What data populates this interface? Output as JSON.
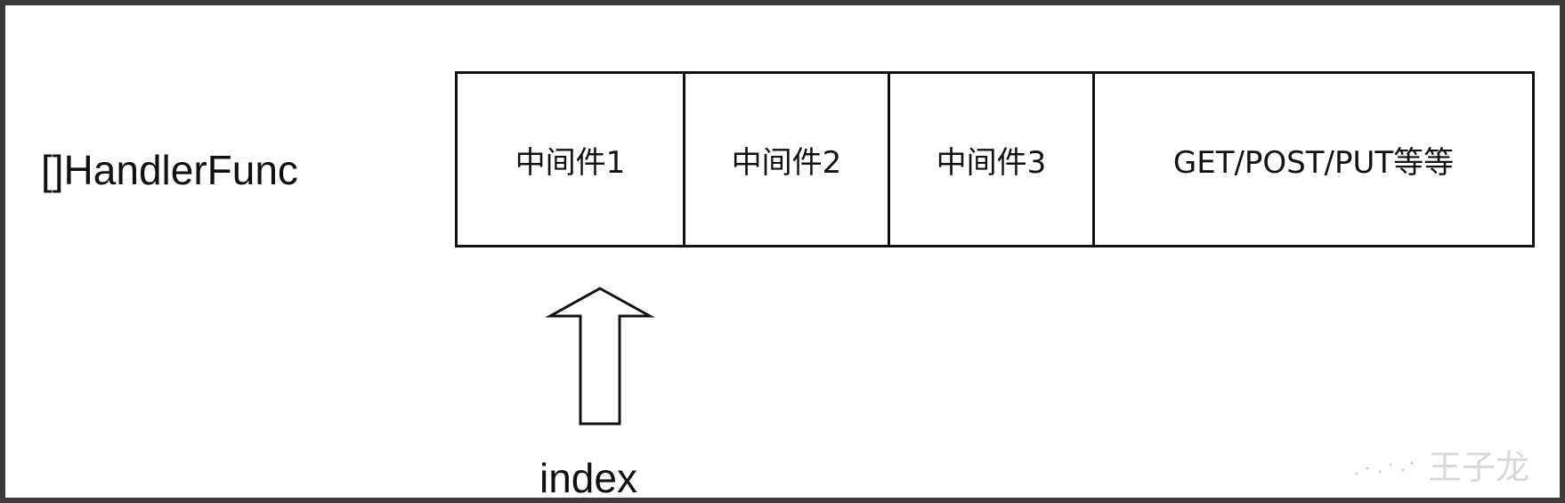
{
  "diagram": {
    "array_label": "[]HandlerFunc",
    "cells": [
      {
        "label": "中间件1"
      },
      {
        "label": "中间件2"
      },
      {
        "label": "中间件3"
      },
      {
        "label": "GET/POST/PUT等等"
      }
    ],
    "pointer_label": "index",
    "watermark": "王子龙"
  }
}
